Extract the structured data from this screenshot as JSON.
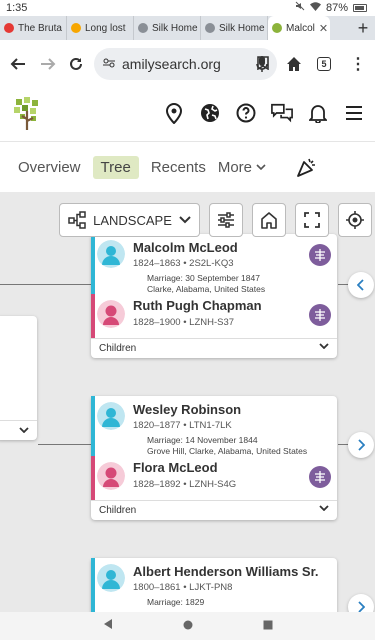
{
  "status_bar": {
    "time": "1:35",
    "battery": "87%"
  },
  "browser": {
    "tabs": [
      {
        "label": "The Bruta",
        "favicon_color": "#e53935"
      },
      {
        "label": "Long lost",
        "favicon_color": "#f7a600"
      },
      {
        "label": "Silk Home",
        "favicon_color": "#8a8f96"
      },
      {
        "label": "Silk Home",
        "favicon_color": "#8a8f96"
      },
      {
        "label": "Malcol",
        "favicon_color": "#8cb33b",
        "active": true
      }
    ],
    "url": "amilysearch.org",
    "tab_count": "5"
  },
  "subnav": {
    "overview": "Overview",
    "tree": "Tree",
    "recents": "Recents",
    "more": "More"
  },
  "toolbar": {
    "layout_label": "LANDSCAPE"
  },
  "couples": [
    {
      "husband": {
        "name": "Malcolm McLeod",
        "info": "1824–1863 • 2S2L-KQ3"
      },
      "marriage_line1": "Marriage: 30 September 1847",
      "marriage_line2": "Clarke, Alabama, United States",
      "wife": {
        "name": "Ruth Pugh Chapman",
        "info": "1828–1900 • LZNH-S37"
      },
      "children_label": "Children"
    },
    {
      "husband": {
        "name": "Wesley Robinson",
        "info": "1820–1877 • LTN1-7LK"
      },
      "marriage_line1": "Marriage: 14 November 1844",
      "marriage_line2": "Grove Hill, Clarke, Alabama, United States",
      "wife": {
        "name": "Flora McLeod",
        "info": "1828–1892 • LZNH-S4G"
      },
      "children_label": "Children"
    },
    {
      "husband": {
        "name": "Albert Henderson Williams Sr.",
        "info": "1800–1861 • LJKT-PN8"
      },
      "marriage_line1": "Marriage: 1829"
    }
  ],
  "colors": {
    "male_bar": "#2fb6d5",
    "female_bar": "#d64977",
    "hint_badge": "#7e5d9c",
    "tree_tab_bg": "#dfe9c3",
    "canvas_bg": "#e9e9e9"
  }
}
